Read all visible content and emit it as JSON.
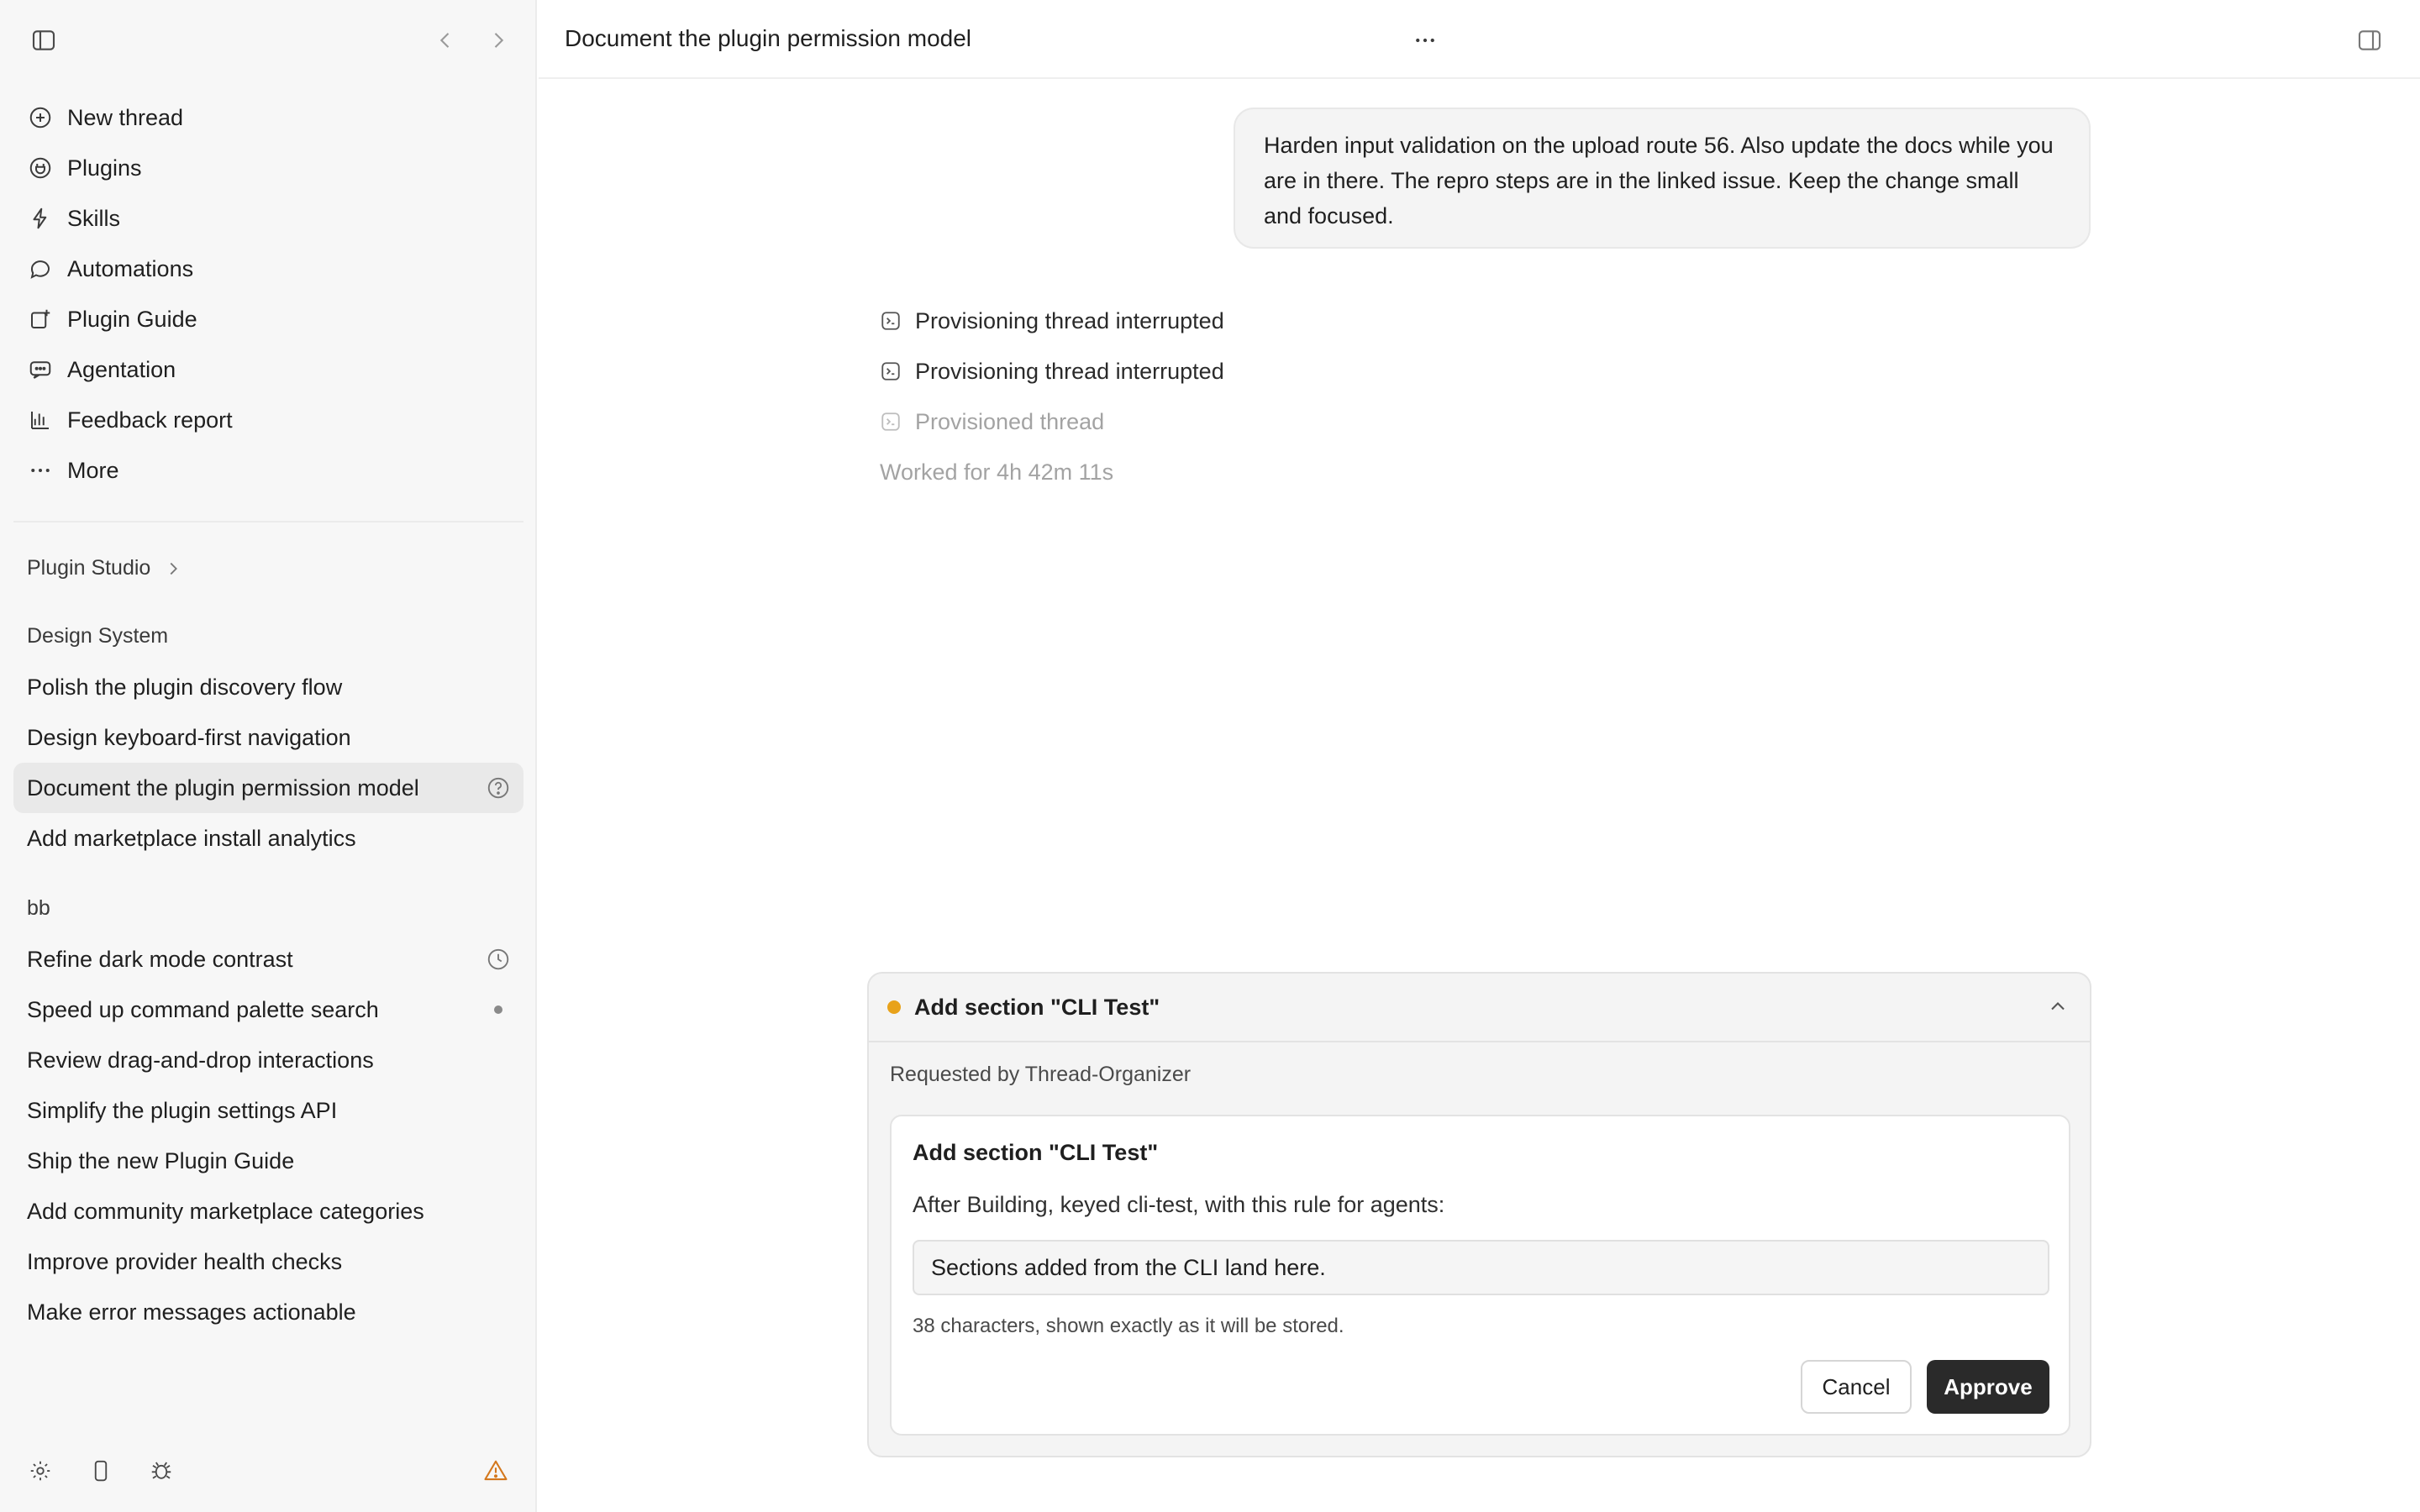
{
  "sidebar": {
    "nav": [
      {
        "label": "New thread",
        "icon": "plus-circle-icon"
      },
      {
        "label": "Plugins",
        "icon": "plugin-icon"
      },
      {
        "label": "Skills",
        "icon": "lightning-icon"
      },
      {
        "label": "Automations",
        "icon": "chat-loop-icon"
      },
      {
        "label": "Plugin Guide",
        "icon": "guide-icon"
      },
      {
        "label": "Agentation",
        "icon": "message-icon"
      },
      {
        "label": "Feedback report",
        "icon": "bar-chart-icon"
      },
      {
        "label": "More",
        "icon": "ellipsis-icon"
      }
    ],
    "plugin_studio": "Plugin Studio",
    "design_system": {
      "label": "Design System",
      "threads": [
        "Polish the plugin discovery flow",
        "Design keyboard-first navigation",
        "Document the plugin permission model",
        "Add marketplace install analytics"
      ]
    },
    "bb": {
      "label": "bb",
      "threads": [
        "Refine dark mode contrast",
        "Speed up command palette search",
        "Review drag-and-drop interactions",
        "Simplify the plugin settings API",
        "Ship the new Plugin Guide",
        "Add community marketplace categories",
        "Improve provider health checks",
        "Make error messages actionable"
      ]
    }
  },
  "header": {
    "title": "Document the plugin permission model"
  },
  "conversation": {
    "user_message": "Harden input validation on the upload route 56. Also update the docs while you are in there. The repro steps are in the linked issue. Keep the change small and focused.",
    "activity": [
      {
        "text": "Provisioning thread interrupted"
      },
      {
        "text": "Provisioning thread interrupted"
      },
      {
        "text": "Provisioned thread"
      }
    ],
    "worked": "Worked for 4h 42m 11s"
  },
  "approval": {
    "title": "Add section \"CLI Test\"",
    "requested_by": "Requested by Thread-Organizer",
    "inner_title": "Add section \"CLI Test\"",
    "description": "After Building, keyed cli-test, with this rule for agents:",
    "field_value": "Sections added from the CLI land here.",
    "note": "38 characters, shown exactly as it will be stored.",
    "cancel": "Cancel",
    "approve": "Approve",
    "status_color": "#e8a21a"
  }
}
